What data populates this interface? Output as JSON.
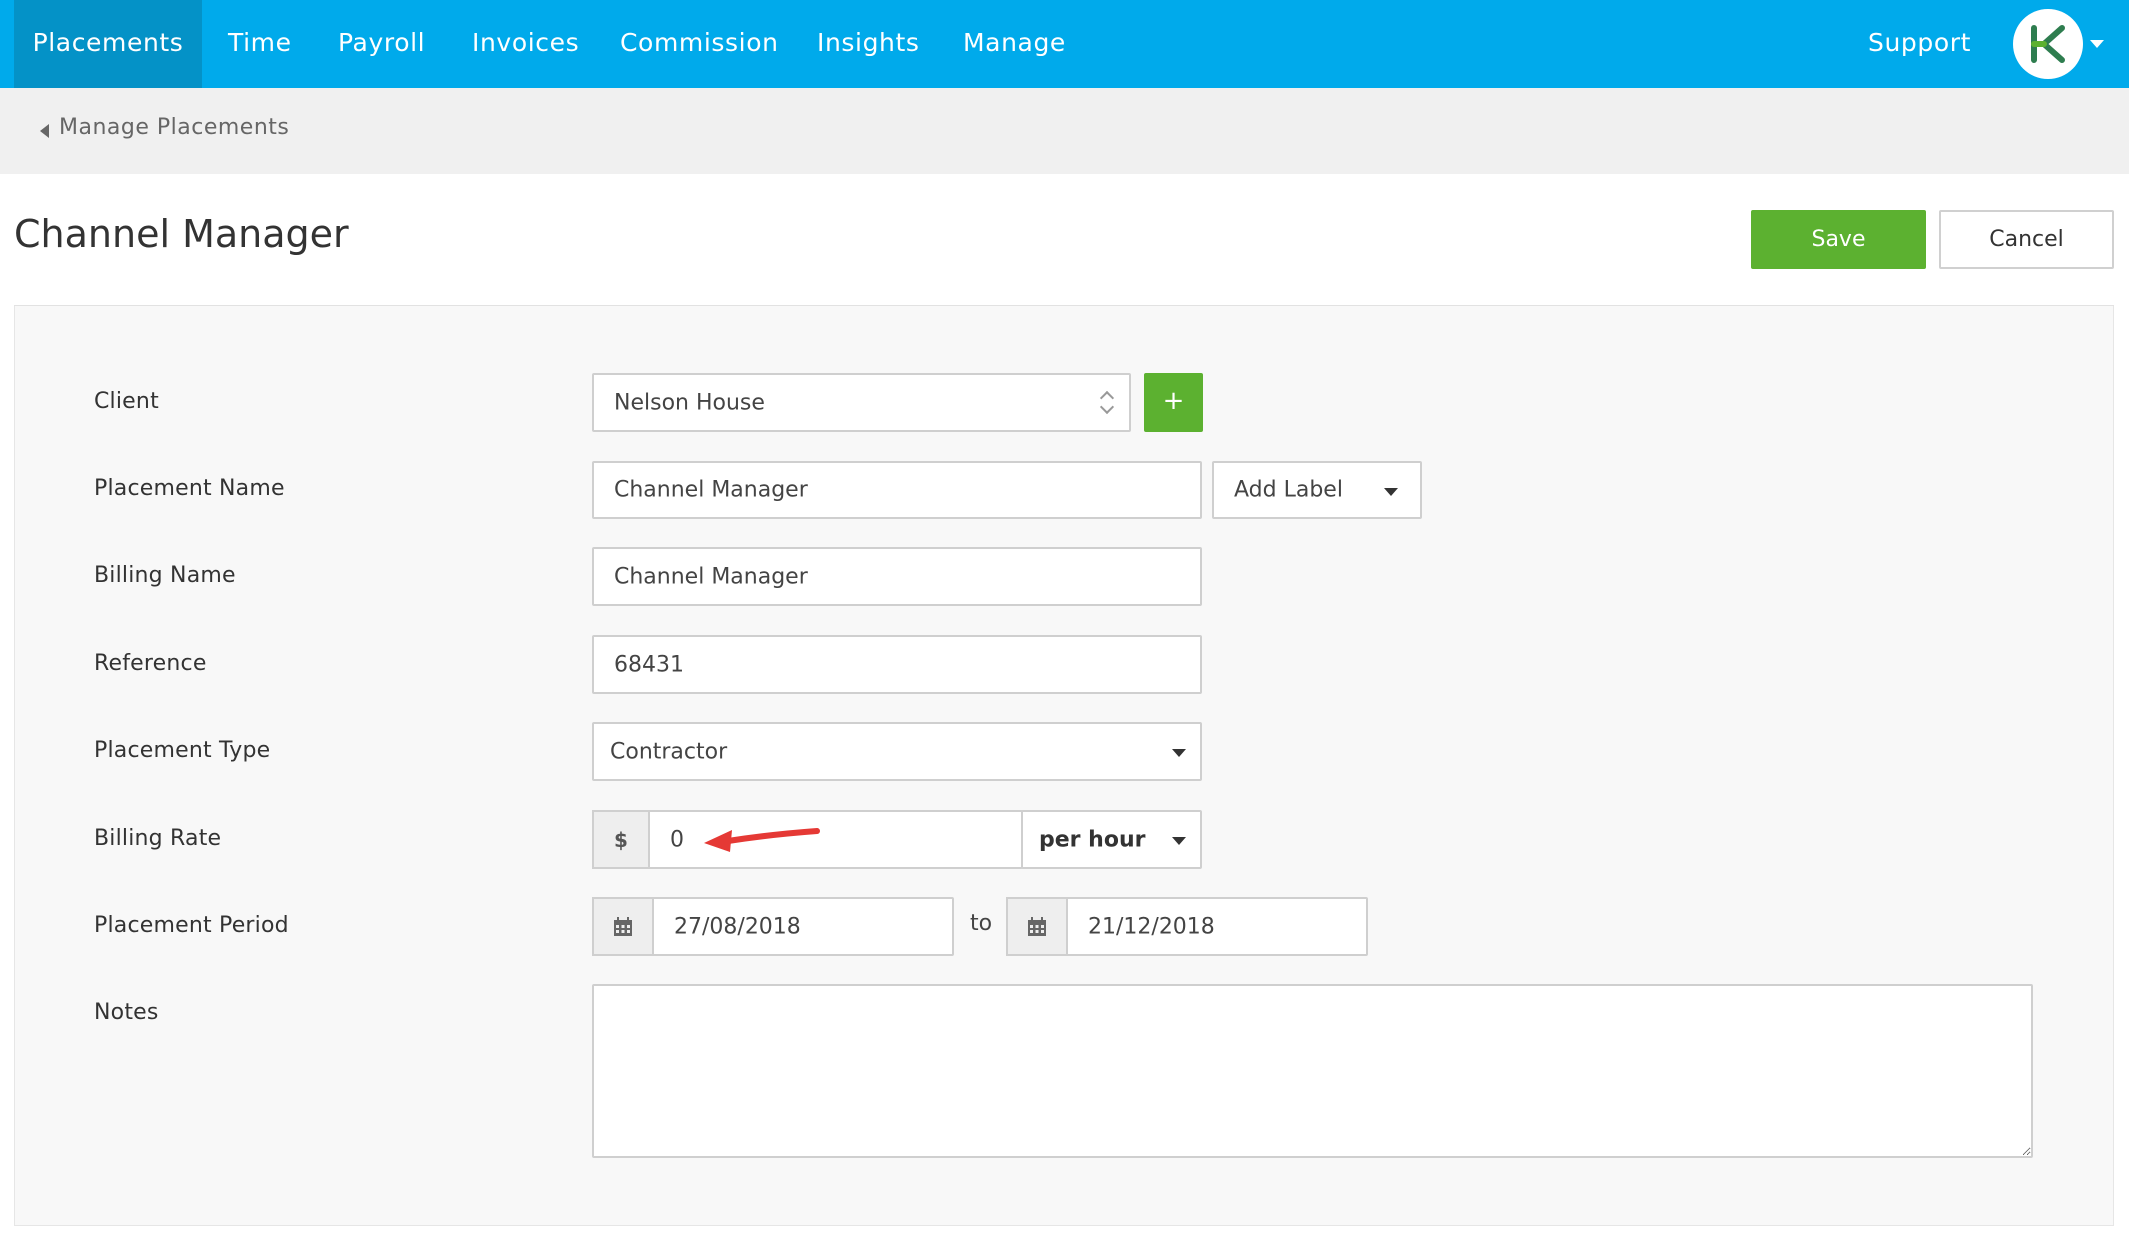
{
  "nav": {
    "items": [
      {
        "label": "Placements",
        "active": true
      },
      {
        "label": "Time"
      },
      {
        "label": "Payroll"
      },
      {
        "label": "Invoices"
      },
      {
        "label": "Commission"
      },
      {
        "label": "Insights"
      },
      {
        "label": "Manage"
      }
    ],
    "support": "Support",
    "avatar_icon": "brand-logo-icon",
    "color": "#00aaeb",
    "active_color": "#0492c7"
  },
  "breadcrumb": {
    "label": "Manage Placements"
  },
  "header": {
    "title": "Channel Manager",
    "save_label": "Save",
    "cancel_label": "Cancel",
    "save_color": "#5cb130"
  },
  "form": {
    "client": {
      "label": "Client",
      "value": "Nelson House",
      "add_label": "+"
    },
    "placement_name": {
      "label": "Placement Name",
      "value": "Channel Manager",
      "tag_select": "Add Label"
    },
    "billing_name": {
      "label": "Billing Name",
      "value": "Channel Manager"
    },
    "reference": {
      "label": "Reference",
      "value": "68431"
    },
    "placement_type": {
      "label": "Placement Type",
      "value": "Contractor"
    },
    "billing_rate": {
      "label": "Billing Rate",
      "currency": "$",
      "value": "0",
      "unit": "per hour"
    },
    "placement_period": {
      "label": "Placement Period",
      "start": "27/08/2018",
      "separator": "to",
      "end": "21/12/2018"
    },
    "notes": {
      "label": "Notes",
      "value": ""
    }
  }
}
